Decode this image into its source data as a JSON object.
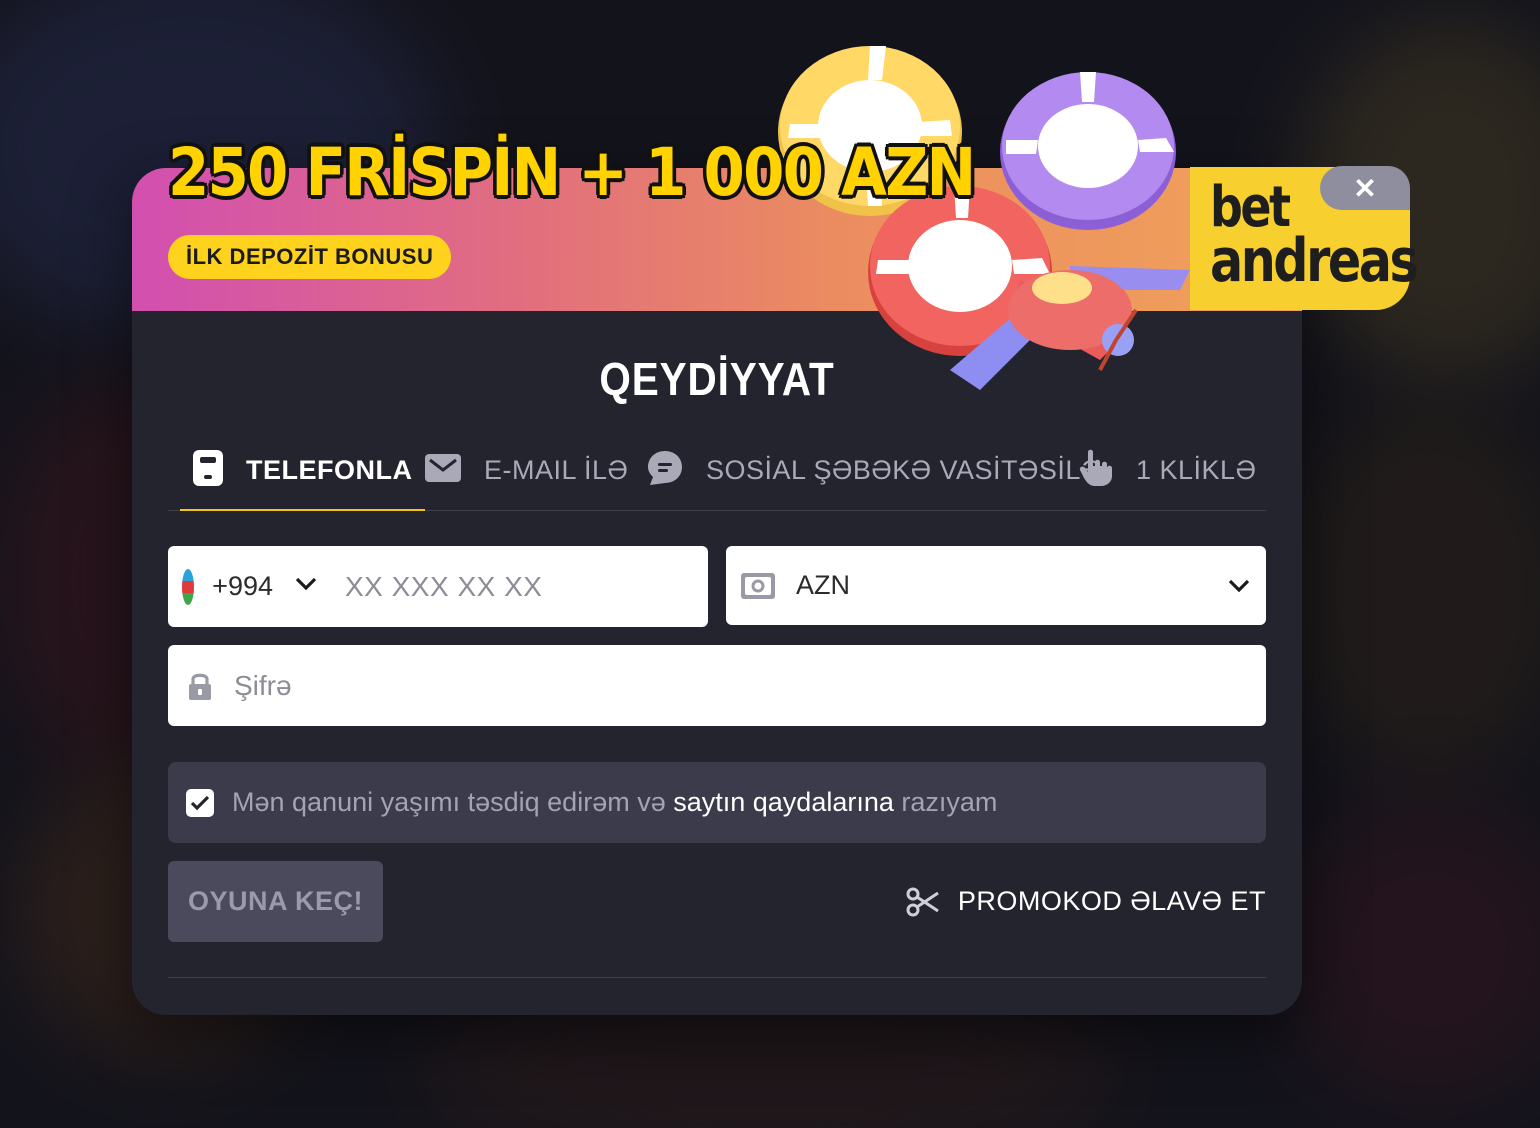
{
  "banner": {
    "title": "250 FRİSPİN + 1 000 AZN",
    "bonus_label": "İLK DEPOZİT BONUSU",
    "logo_line1": "bet",
    "logo_line2": "andreas",
    "close_label": "✕"
  },
  "form": {
    "title": "QEYDİYYAT",
    "tabs": [
      {
        "label": "TELEFONLA",
        "icon": "phone-icon",
        "active": true
      },
      {
        "label": "E-MAIL İLƏ",
        "icon": "mail-icon",
        "active": false
      },
      {
        "label": "SOSİAL ŞƏBƏKƏ VASİTƏSİLƏ",
        "icon": "chat-icon",
        "active": false
      },
      {
        "label": "1 KLİKLƏ",
        "icon": "hand-pointer-icon",
        "active": false
      }
    ],
    "phone": {
      "country_code": "+994",
      "placeholder": "XX XXX XX XX",
      "value": ""
    },
    "currency": {
      "value": "AZN"
    },
    "password": {
      "placeholder": "Şifrə",
      "value": ""
    },
    "consent": {
      "checked": true,
      "text_before": "Mən qanuni yaşımı təsdiq edirəm və",
      "link": "saytın qaydalarına",
      "text_after": "razıyam"
    },
    "submit_label": "OYUNA KEÇ!",
    "promo_label": "PROMOKOD ƏLAVƏ ET"
  },
  "colors": {
    "accent": "#f2c51d",
    "modal_bg": "#24242f",
    "banner_start": "#d24fb0",
    "banner_end": "#f0a25a",
    "logo_bg": "#f7cf2e"
  }
}
